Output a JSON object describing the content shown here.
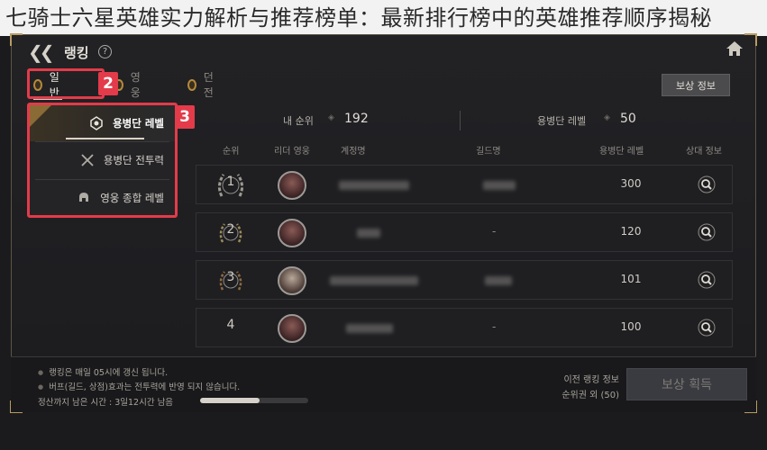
{
  "banner": {
    "title": "七骑士六星英雄实力解析与推荐榜单：最新排行榜中的英雄推荐顺序揭秘"
  },
  "window": {
    "title": "랭킹",
    "help": "?"
  },
  "tabs": [
    {
      "label": "일반",
      "active": true
    },
    {
      "label": "영웅",
      "active": false
    },
    {
      "label": "던전",
      "active": false
    }
  ],
  "reward_info_button": "보상 정보",
  "annotations": {
    "badge_2": "2",
    "badge_3": "3"
  },
  "dropdown": {
    "items": [
      {
        "label": "용병단 레벨",
        "icon": "mercenary-emblem-icon",
        "selected": true
      },
      {
        "label": "용병단 전투력",
        "icon": "crossed-swords-icon",
        "selected": false
      },
      {
        "label": "영웅 종합 레벨",
        "icon": "helmet-icon",
        "selected": false
      }
    ]
  },
  "summary": {
    "my_rank_label": "내 순위",
    "my_rank_value": "192",
    "level_label": "용병단 레벨",
    "level_value": "50"
  },
  "columns": {
    "rank": "순위",
    "leader": "리더 영웅",
    "account": "계정명",
    "guild": "길드명",
    "level": "용병단 레벨",
    "details": "상대 정보"
  },
  "rows": [
    {
      "rank": "1",
      "laurel": true,
      "guild": "",
      "level": "300"
    },
    {
      "rank": "2",
      "laurel": true,
      "guild": "-",
      "level": "120"
    },
    {
      "rank": "3",
      "laurel": true,
      "guild": "",
      "level": "101"
    },
    {
      "rank": "4",
      "laurel": false,
      "guild": "-",
      "level": "100"
    }
  ],
  "footer": {
    "note1": "랭킹은 매일 05시에 갱신 됩니다.",
    "note2": "버프(길드, 상점)효과는 전투력에 반영 되지 않습니다.",
    "remaining": "정산까지 남은 시간 :  3일12시간 남음",
    "remaining_progress": 0.55,
    "prev_rank_label": "이전 랭킹 정보",
    "prev_rank_value": "순위권 외 (50)",
    "claim_button": "보상 획득"
  },
  "colors": {
    "highlight": "#e33b4a",
    "gold": "#b99b62"
  }
}
